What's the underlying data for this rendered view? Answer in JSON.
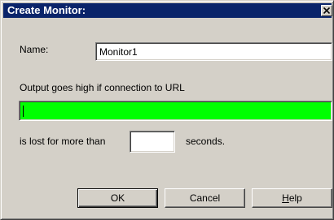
{
  "window": {
    "title": "Create Monitor:",
    "close_icon": "close-icon"
  },
  "form": {
    "name_label": "Name:",
    "name_value": "Monitor1",
    "output_label": "Output goes high if connection to URL",
    "url_value": "",
    "url_field_color": "#00ff00",
    "lost_label": "is lost for more than",
    "seconds_value": "",
    "seconds_label": "seconds."
  },
  "buttons": {
    "ok_label": "OK",
    "cancel_label": "Cancel",
    "help_label_mnemonic": "H",
    "help_label_rest": "elp"
  },
  "colors": {
    "titlebar": "#0a246a",
    "dialog_bg": "#d4d0c8"
  }
}
